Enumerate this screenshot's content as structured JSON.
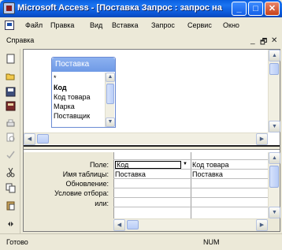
{
  "window": {
    "title": "Microsoft Access - [Поставка Запрос : запрос на",
    "minimize_glyph": "_",
    "maximize_glyph": "□",
    "close_glyph": "✕"
  },
  "menu": {
    "items": [
      "Файл",
      "Правка",
      "Вид",
      "Вставка",
      "Запрос",
      "Сервис",
      "Окно"
    ],
    "help": "Справка",
    "mdi_min": "_",
    "mdi_restore": "🗗",
    "mdi_close": "✕"
  },
  "field_list": {
    "title": "Поставка",
    "items": [
      "*",
      "Код",
      "Код товара",
      "Марка",
      "Поставщик"
    ]
  },
  "grid": {
    "row_labels": [
      "Поле:",
      "Имя таблицы:",
      "Обновление:",
      "Условие отбора:",
      "или:"
    ],
    "columns": [
      {
        "field": "Код",
        "table": "Поставка"
      },
      {
        "field": "Код товара",
        "table": "Поставка"
      }
    ]
  },
  "status": {
    "text": "Готово",
    "num": "NUM"
  },
  "icons": [
    "app-icon",
    "new-icon",
    "open-icon",
    "save-icon",
    "print-icon",
    "preview-icon",
    "spell-icon",
    "cut-icon",
    "copy-icon",
    "paste-icon"
  ]
}
